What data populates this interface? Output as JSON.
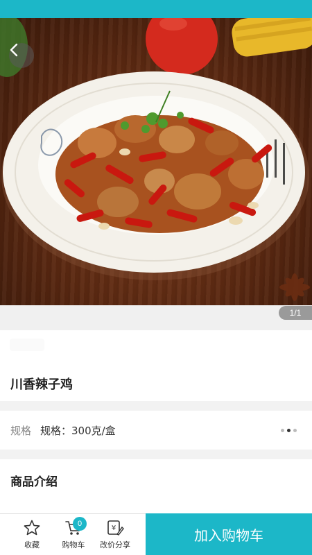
{
  "colors": {
    "accent": "#1cb7c8",
    "status_bar": "#1cb7c8"
  },
  "gallery": {
    "counter": "1/1",
    "image_subject": "sichuan spicy chicken dish"
  },
  "product": {
    "name": "川香辣子鸡"
  },
  "spec": {
    "label": "规格",
    "value": "规格：300克/盒",
    "dots_count": 3,
    "active_dot": 1
  },
  "intro": {
    "title": "商品介绍"
  },
  "bottom_bar": {
    "favorite_label": "收藏",
    "cart_label": "购物车",
    "cart_count": "0",
    "share_label": "改价分享",
    "add_to_cart_label": "加入购物车"
  },
  "icons": {
    "back": "back-arrow-icon",
    "favorite": "star-icon",
    "cart": "cart-icon",
    "share": "price-edit-icon"
  }
}
